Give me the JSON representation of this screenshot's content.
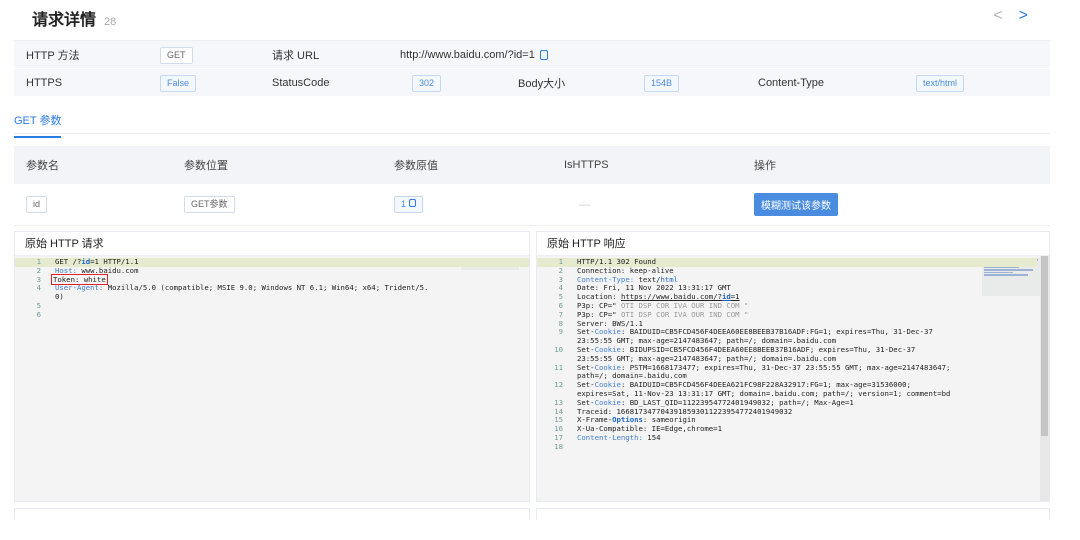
{
  "header": {
    "title": "请求详情",
    "count": "28",
    "prev": "<",
    "next": ">"
  },
  "info": {
    "method_label": "HTTP 方法",
    "method_value": "GET",
    "url_label": "请求 URL",
    "url_value": "http://www.baidu.com/?id=1",
    "https_label": "HTTPS",
    "https_value": "False",
    "status_label": "StatusCode",
    "status_value": "302",
    "body_label": "Body大小",
    "body_value": "154B",
    "ctype_label": "Content-Type",
    "ctype_value": "text/html"
  },
  "tabs": {
    "active": "GET 参数"
  },
  "params": {
    "headers": [
      "参数名",
      "参数位置",
      "参数原值",
      "IsHTTPS",
      "操作"
    ],
    "row": {
      "name": "id",
      "position": "GET参数",
      "value": "1",
      "ishttps": "—",
      "action": "模糊测试该参数"
    }
  },
  "request": {
    "title": "原始 HTTP 请求",
    "lines": [
      "1",
      "2",
      "3",
      "4",
      "",
      "5",
      "6"
    ],
    "l1_a": "GET /?",
    "l1_b": "id",
    "l1_c": "=1 HTTP/1.1",
    "l2_a": "Host:",
    "l2_b": " www.baidu.com",
    "l3": "Token: white",
    "l4_a": "User-Agent:",
    "l4_b": " Mozilla/5.0 (compatible; MSIE 9.0; Windows NT 6.1; Win64; x64; Trident/5.",
    "l4_c": "0)"
  },
  "response": {
    "title": "原始 HTTP 响应",
    "lines": [
      "1",
      "2",
      "3",
      "4",
      "5",
      "6",
      "7",
      "8",
      "9",
      "",
      "10",
      "",
      "11",
      "",
      "12",
      "",
      "13",
      "14",
      "15",
      "16",
      "17",
      "18"
    ],
    "l1": "HTTP/1.1 302 Found",
    "l2": "Connection: keep-alive",
    "l3_a": "Content-Type:",
    "l3_b": " text/",
    "l3_c": "html",
    "l4": "Date: Fri, 11 Nov 2022 13:31:17 GMT",
    "l5_a": "Location: ",
    "l5_b": "https://www.baidu.com/?",
    "l5_c": "id",
    "l5_d": "=1",
    "l6_a": "P3p: CP=\"",
    "l6_b": " OTI DSP COR IVA OUR IND COM \"",
    "l7_a": "P3p: CP=\"",
    "l7_b": " OTI DSP COR IVA OUR IND COM \"",
    "l8": "Server: BWS/1.1",
    "l9_a": "Set-",
    "l9_b": "Cookie",
    "l9_c": ": BAIDUID=CB5FCD456F4DEEA60EE8BEEB37B16ADF:FG=1; expires=Thu, 31-Dec-37",
    "l9_d": "23:55:55 GMT; max-age=2147483647; path=/; domain=.baidu.com",
    "l10_a": "Set-",
    "l10_b": "Cookie",
    "l10_c": ": BIDUPSID=CB5FCD456F4DEEA60EE8BEEB37B16ADF; expires=Thu, 31-Dec-37",
    "l10_d": "23:55:55 GMT; max-age=2147483647; path=/; domain=.baidu.com",
    "l11_a": "Set-",
    "l11_b": "Cookie",
    "l11_c": ": PSTM=1668173477; expires=Thu, 31-Dec-37 23:55:55 GMT; max-age=2147483647;",
    "l11_d": "path=/; domain=.baidu.com",
    "l12_a": "Set-",
    "l12_b": "Cookie",
    "l12_c": ": BAIDUID=CB5FCD456F4DEEA621FC98F228A32917:FG=1; max-age=31536000;",
    "l12_d": "expires=Sat, 11-Nov-23 13:31:17 GMT; domain=.baidu.com; path=/; version=1; comment=bd",
    "l13_a": "Set-",
    "l13_b": "Cookie",
    "l13_c": ": BD_LAST_QID=11223954772401949032; path=/; Max-Age=1",
    "l14": "Traceid: 1668173477043918593011223954772401949032",
    "l15_a": "X-Frame-",
    "l15_b": "Options",
    "l15_c": ": sameorigin",
    "l16": "X-Ua-Compatible: IE=Edge,chrome=1",
    "l17_a": "Content-Length:",
    "l17_b": " 154"
  },
  "colors": {
    "accent": "#2d7be5",
    "button": "#4a8de0",
    "highlight_line": "#e6ebcf",
    "token_box": "#e0242a"
  }
}
